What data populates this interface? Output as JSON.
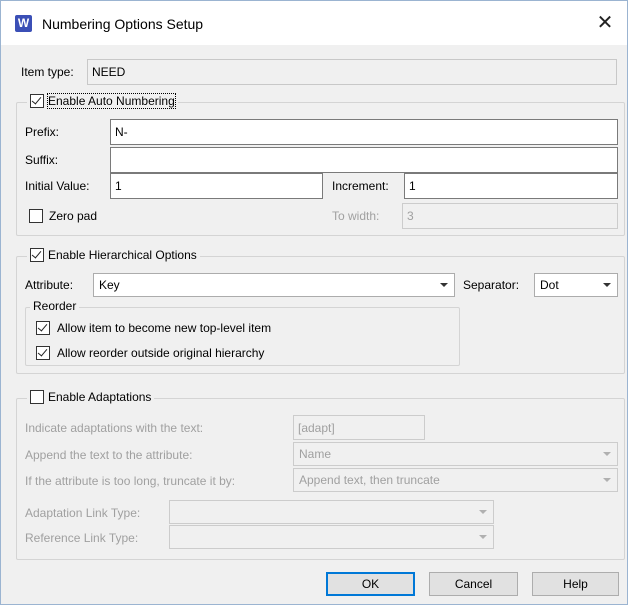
{
  "window": {
    "title": "Numbering Options Setup",
    "app_icon_letter": "W",
    "close_glyph": "✕"
  },
  "item_type": {
    "label": "Item type:",
    "value": "NEED"
  },
  "auto_numbering": {
    "label": "Enable Auto Numbering",
    "checked": true,
    "prefix_label": "Prefix:",
    "prefix_value": "N-",
    "suffix_label": "Suffix:",
    "suffix_value": "",
    "initial_label": "Initial Value:",
    "initial_value": "1",
    "increment_label": "Increment:",
    "increment_value": "1",
    "zero_pad_label": "Zero pad",
    "zero_pad_checked": false,
    "to_width_label": "To width:",
    "to_width_value": "3"
  },
  "hierarchical": {
    "label": "Enable Hierarchical Options",
    "checked": true,
    "attribute_label": "Attribute:",
    "attribute_value": "Key",
    "separator_label": "Separator:",
    "separator_value": "Dot",
    "reorder_label": "Reorder",
    "allow_top_label": "Allow item to become new top-level item",
    "allow_top_checked": true,
    "allow_outside_label": "Allow reorder outside original hierarchy",
    "allow_outside_checked": true
  },
  "adaptations": {
    "label": "Enable Adaptations",
    "checked": false,
    "indicate_label": "Indicate adaptations with the text:",
    "indicate_value": "[adapt]",
    "append_label": "Append the text to the attribute:",
    "append_value": "Name",
    "truncate_label": "If the attribute is too long, truncate it by:",
    "truncate_value": "Append text, then truncate",
    "adapt_link_label": "Adaptation Link Type:",
    "adapt_link_value": "",
    "ref_link_label": "Reference Link Type:",
    "ref_link_value": ""
  },
  "buttons": {
    "ok": "OK",
    "cancel": "Cancel",
    "help": "Help"
  }
}
